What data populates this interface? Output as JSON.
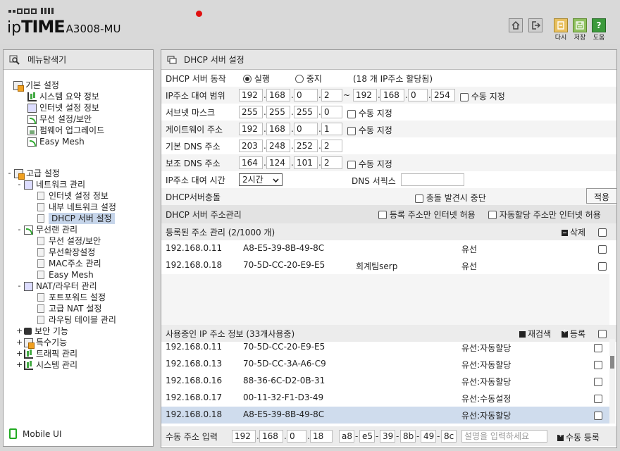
{
  "header": {
    "brand_prefix": "ip",
    "brand_main": "TIME",
    "model": "A3008-MU",
    "buttons": [
      {
        "icon": "home-icon",
        "label": ""
      },
      {
        "icon": "logout-icon",
        "label": ""
      },
      {
        "icon": "refresh-icon",
        "label": "다시"
      },
      {
        "icon": "save-icon",
        "label": "저장"
      },
      {
        "icon": "help-icon",
        "label": "도움"
      }
    ],
    "help_glyph": "?"
  },
  "sidebar": {
    "title": "메뉴탐색기",
    "basic": {
      "label": "기본 설정",
      "items": [
        "시스템 요약 정보",
        "인터넷 설정 정보",
        "무선 설정/보안",
        "펌웨어 업그레이드",
        "Easy Mesh"
      ]
    },
    "advanced": {
      "label": "고급 설정",
      "expander": "-",
      "network": {
        "label": "네트워크 관리",
        "expander": "-",
        "items": [
          "인터넷 설정 정보",
          "내부 네트워크 설정",
          "DHCP 서버 설정"
        ]
      },
      "wireless": {
        "label": "무선랜 관리",
        "expander": "-",
        "items": [
          "무선 설정/보안",
          "무선확장설정",
          "MAC주소 관리",
          "Easy Mesh"
        ]
      },
      "nat": {
        "label": "NAT/라우터 관리",
        "expander": "-",
        "items": [
          "포트포워드 설정",
          "고급 NAT 설정",
          "라우팅 테이블 관리"
        ]
      },
      "collapsed": [
        {
          "label": "보안 기능",
          "expander": "+"
        },
        {
          "label": "특수기능",
          "expander": "+"
        },
        {
          "label": "트래픽 관리",
          "expander": "+"
        },
        {
          "label": "시스템 관리",
          "expander": "+"
        }
      ]
    },
    "mobile_ui": "Mobile UI"
  },
  "main": {
    "title": "DHCP 서버 설정",
    "dhcp_action": {
      "label": "DHCP 서버 동작",
      "run": "실행",
      "stop": "중지",
      "note": "(18 개 IP주소 할당됨)"
    },
    "lease_range": {
      "label": "IP주소 대여 범위",
      "start": [
        "192",
        "168",
        "0",
        "2"
      ],
      "tilde": "~",
      "end": [
        "192",
        "168",
        "0",
        "254"
      ],
      "manual": "수동 지정"
    },
    "subnet": {
      "label": "서브넷 마스크",
      "value": [
        "255",
        "255",
        "255",
        "0"
      ],
      "manual": "수동 지정"
    },
    "gateway": {
      "label": "게이트웨이 주소",
      "value": [
        "192",
        "168",
        "0",
        "1"
      ],
      "manual": "수동 지정"
    },
    "dns1": {
      "label": "기본 DNS 주소",
      "value": [
        "203",
        "248",
        "252",
        "2"
      ]
    },
    "dns2": {
      "label": "보조 DNS 주소",
      "value": [
        "164",
        "124",
        "101",
        "2"
      ],
      "manual": "수동 지정"
    },
    "lease_time": {
      "label": "IP주소 대여 시간",
      "value": "2시간",
      "dns_suffix_label": "DNS 서픽스",
      "dns_suffix_value": ""
    },
    "conflict": {
      "label": "DHCP서버충돌",
      "stop_label": "충돌 발견시 중단",
      "apply": "적용"
    },
    "address_mgmt": {
      "title": "DHCP 서버 주소관리",
      "opt1": "등록 주소만 인터넷 허용",
      "opt2": "자동할당 주소만 인터넷 허용"
    },
    "registered": {
      "title": "등록된 주소 관리 (2/1000 개)",
      "delete": "삭제",
      "rows": [
        {
          "ip": "192.168.0.11",
          "mac": "A8-E5-39-8B-49-8C",
          "desc": "",
          "type": "유선"
        },
        {
          "ip": "192.168.0.18",
          "mac": "70-5D-CC-20-E9-E5",
          "desc": "회계팀serp",
          "type": "유선"
        }
      ]
    },
    "in_use": {
      "title": "사용중인 IP 주소 정보 (33개사용중)",
      "rescan": "재검색",
      "register": "등록",
      "rows": [
        {
          "ip": "192.168.0.11",
          "mac": "70-5D-CC-20-E9-E5",
          "type": "유선:자동할당"
        },
        {
          "ip": "192.168.0.13",
          "mac": "70-5D-CC-3A-A6-C9",
          "type": "유선:자동할당"
        },
        {
          "ip": "192.168.0.16",
          "mac": "88-36-6C-D2-0B-31",
          "type": "유선:자동할당"
        },
        {
          "ip": "192.168.0.17",
          "mac": "00-11-32-F1-D3-49",
          "type": "유선:수동설정"
        },
        {
          "ip": "192.168.0.18",
          "mac": "A8-E5-39-8B-49-8C",
          "type": "유선:자동할당"
        }
      ]
    },
    "manual_input": {
      "label": "수동 주소 입력",
      "ip": [
        "192",
        "168",
        "0",
        "18"
      ],
      "mac": [
        "a8",
        "e5",
        "39",
        "8b",
        "49",
        "8c"
      ],
      "desc_placeholder": "설명을 입력하세요",
      "register": "수동 등록"
    }
  }
}
